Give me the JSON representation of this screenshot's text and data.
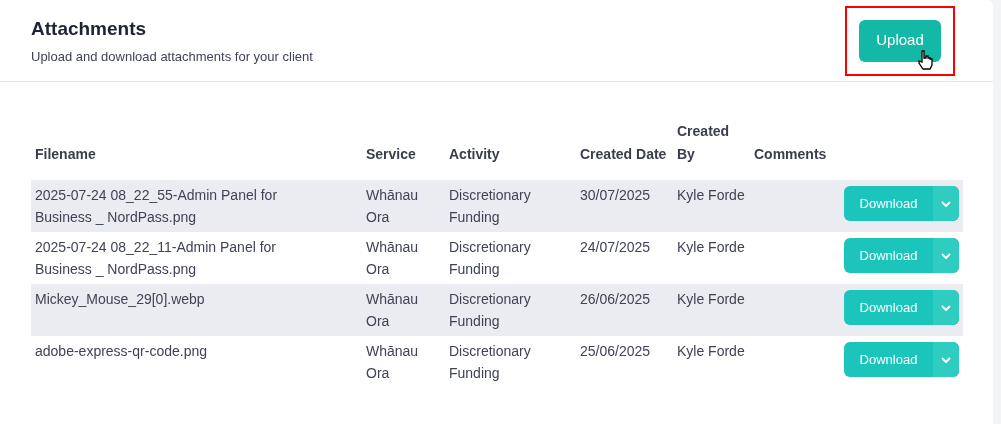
{
  "header": {
    "title": "Attachments",
    "subtitle": "Upload and download attachments for your client",
    "upload_button": "Upload",
    "highlighted": true
  },
  "table": {
    "columns": [
      "Filename",
      "Service",
      "Activity",
      "Created Date",
      "Created By",
      "Comments"
    ],
    "rows": [
      {
        "filename": "2025-07-24 08_22_55-Admin Panel for Business _ NordPass.png",
        "service": "Whānau Ora",
        "activity": "Discretionary Funding",
        "created_date": "30/07/2025",
        "created_by": "Kyle Forde",
        "comments": "",
        "action": "Download"
      },
      {
        "filename": "2025-07-24 08_22_11-Admin Panel for Business _ NordPass.png",
        "service": "Whānau Ora",
        "activity": "Discretionary Funding",
        "created_date": "24/07/2025",
        "created_by": "Kyle Forde",
        "comments": "",
        "action": "Download"
      },
      {
        "filename": "Mickey_Mouse_29[0].webp",
        "service": "Whānau Ora",
        "activity": "Discretionary Funding",
        "created_date": "26/06/2025",
        "created_by": "Kyle Forde",
        "comments": "",
        "action": "Download"
      },
      {
        "filename": "adobe-express-qr-code.png",
        "service": "Whānau Ora",
        "activity": "Discretionary Funding",
        "created_date": "25/06/2025",
        "created_by": "Kyle Forde",
        "comments": "",
        "action": "Download"
      }
    ]
  }
}
